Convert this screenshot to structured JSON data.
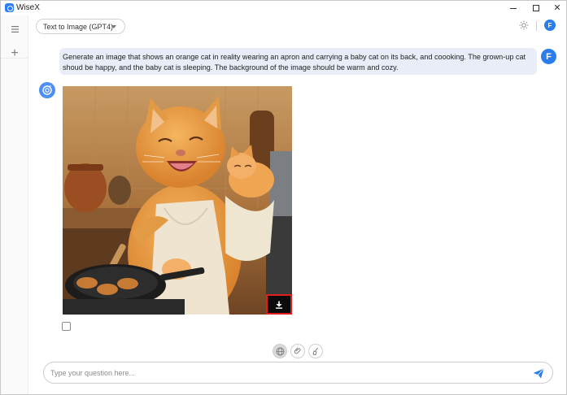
{
  "app": {
    "title": "WiseX",
    "accent_color": "#2b7de9"
  },
  "window_controls": {
    "minimize_icon": "minimize-icon",
    "maximize_icon": "maximize-icon",
    "close_icon": "close-icon",
    "close_label": "✕"
  },
  "sidebar": {
    "menu_icon": "hamburger-menu-icon",
    "new_chat_icon": "plus-icon",
    "new_chat_label": "+"
  },
  "header": {
    "model_selector": {
      "selected": "Text to Image (GPT4)"
    },
    "theme_icon": "sun-icon",
    "user_avatar_letter": "F"
  },
  "conversation": {
    "user_message": {
      "avatar_letter": "F",
      "text": "Generate an image that shows an orange cat in reality wearing an apron and carrying a baby cat on its back, and coooking. The grown-up cat shoud be happy, and the baby cat is sleeping. The background of the image should be warm and cozy."
    },
    "bot_message": {
      "avatar_icon": "bot-avatar-icon",
      "image_description_icon": "generated-image",
      "download_icon": "download-icon",
      "copy_icon": "copy-icon"
    }
  },
  "tools": [
    {
      "name": "web-search",
      "icon": "globe-icon"
    },
    {
      "name": "attach-file",
      "icon": "paperclip-icon"
    },
    {
      "name": "clear",
      "icon": "broom-icon"
    }
  ],
  "composer": {
    "placeholder": "Type your question here...",
    "value": "",
    "send_icon": "send-icon"
  }
}
